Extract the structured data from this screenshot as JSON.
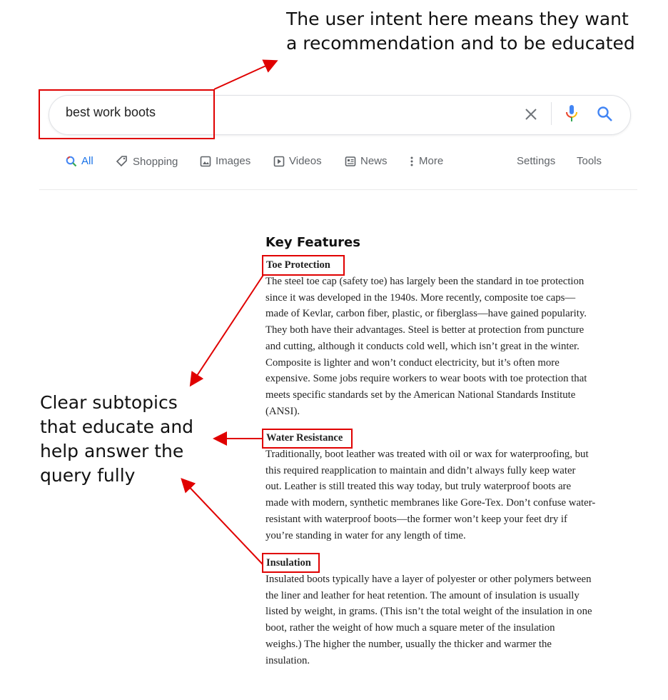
{
  "annotations": {
    "intent": [
      "The user intent here means they want",
      "a recommendation and to be educated"
    ],
    "subtopics": [
      "Clear subtopics",
      "that educate and",
      "help answer the",
      "query fully"
    ],
    "highlight_color": "#e00000"
  },
  "search": {
    "query": "best work boots",
    "clear_icon": "close-icon",
    "mic_icon": "microphone-icon",
    "search_icon": "search-icon"
  },
  "tabs": [
    {
      "label": "All",
      "icon": "search-icon",
      "active": true
    },
    {
      "label": "Shopping",
      "icon": "tag-icon"
    },
    {
      "label": "Images",
      "icon": "image-icon"
    },
    {
      "label": "Videos",
      "icon": "play-icon"
    },
    {
      "label": "News",
      "icon": "news-icon"
    },
    {
      "label": "More",
      "icon": "dots-vertical-icon"
    }
  ],
  "tools": {
    "settings": "Settings",
    "tools": "Tools"
  },
  "article": {
    "heading": "Key Features",
    "sections": [
      {
        "title": "Toe Protection",
        "lines": [
          "The steel toe cap (safety toe) has largely been the standard in toe protection",
          "since it was developed in the 1940s. More recently, composite toe caps—",
          "made of Kevlar, carbon fiber, plastic, or fiberglass—have gained popularity.",
          "They both have their advantages. Steel is better at protection from puncture",
          "and cutting, although it conducts cold well, which isn’t great in the winter.",
          "Composite is lighter and won’t conduct electricity, but it’s often more",
          "expensive. Some jobs require workers to wear boots with toe protection that",
          "meets specific standards set by the American National Standards Institute",
          "(ANSI)."
        ]
      },
      {
        "title": "Water Resistance",
        "lines": [
          "Traditionally, boot leather was treated with oil or wax for waterproofing, but",
          "this required reapplication to maintain and didn’t always fully keep water",
          "out. Leather is still treated this way today, but truly waterproof boots are",
          "made with modern, synthetic membranes like Gore-Tex. Don’t confuse water-",
          "resistant with waterproof boots—the former won’t keep your feet dry if",
          "you’re standing in water for any length of time."
        ]
      },
      {
        "title": "Insulation",
        "lines": [
          "Insulated boots typically have a layer of polyester or other polymers between",
          "the liner and leather for heat retention. The amount of insulation is usually",
          "listed by weight, in grams. (This isn’t the total weight of the insulation in one",
          "boot, rather the weight of how much a square meter of the insulation",
          "weighs.) The higher the number, usually the thicker and warmer the",
          "insulation."
        ]
      }
    ]
  }
}
